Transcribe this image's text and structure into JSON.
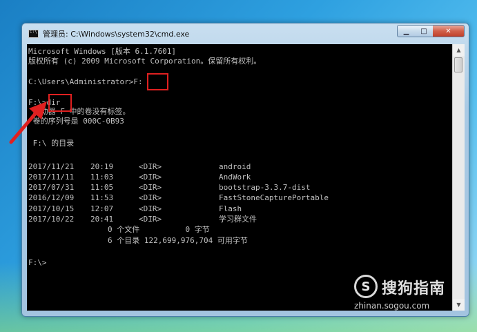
{
  "window": {
    "title": "管理员: C:\\Windows\\system32\\cmd.exe",
    "buttons": {
      "minimize": "▁",
      "maximize": "□",
      "close": "✕"
    }
  },
  "console": {
    "header_line1": "Microsoft Windows [版本 6.1.7601]",
    "header_line2": "版权所有 (c) 2009 Microsoft Corporation。保留所有权利。",
    "prompt1": "C:\\Users\\Administrator>F:",
    "prompt2": "F:\\>dir",
    "volume_label": " 驱动器 F 中的卷没有标签。",
    "volume_serial": " 卷的序列号是 000C-0B93",
    "dir_of": " F:\\ 的目录",
    "entries": [
      {
        "date": "2017/11/21",
        "time": "20:19",
        "type": "<DIR>",
        "name": "android"
      },
      {
        "date": "2017/11/11",
        "time": "11:03",
        "type": "<DIR>",
        "name": "AndWork"
      },
      {
        "date": "2017/07/31",
        "time": "11:05",
        "type": "<DIR>",
        "name": "bootstrap-3.3.7-dist"
      },
      {
        "date": "2016/12/09",
        "time": "11:53",
        "type": "<DIR>",
        "name": "FastStoneCapturePortable"
      },
      {
        "date": "2017/10/15",
        "time": "12:07",
        "type": "<DIR>",
        "name": "Flash"
      },
      {
        "date": "2017/10/22",
        "time": "20:41",
        "type": "<DIR>",
        "name": "学习群文件"
      }
    ],
    "summary_files": "0 个文件          0 字节",
    "summary_dirs": "6 个目录 122,699,976,704 可用字节",
    "prompt3": "F:\\>"
  },
  "scrollbar": {
    "up": "▲",
    "down": "▼"
  },
  "watermark": {
    "logo": "S",
    "name": "搜狗指南",
    "url": "zhinan.sogou.com"
  }
}
